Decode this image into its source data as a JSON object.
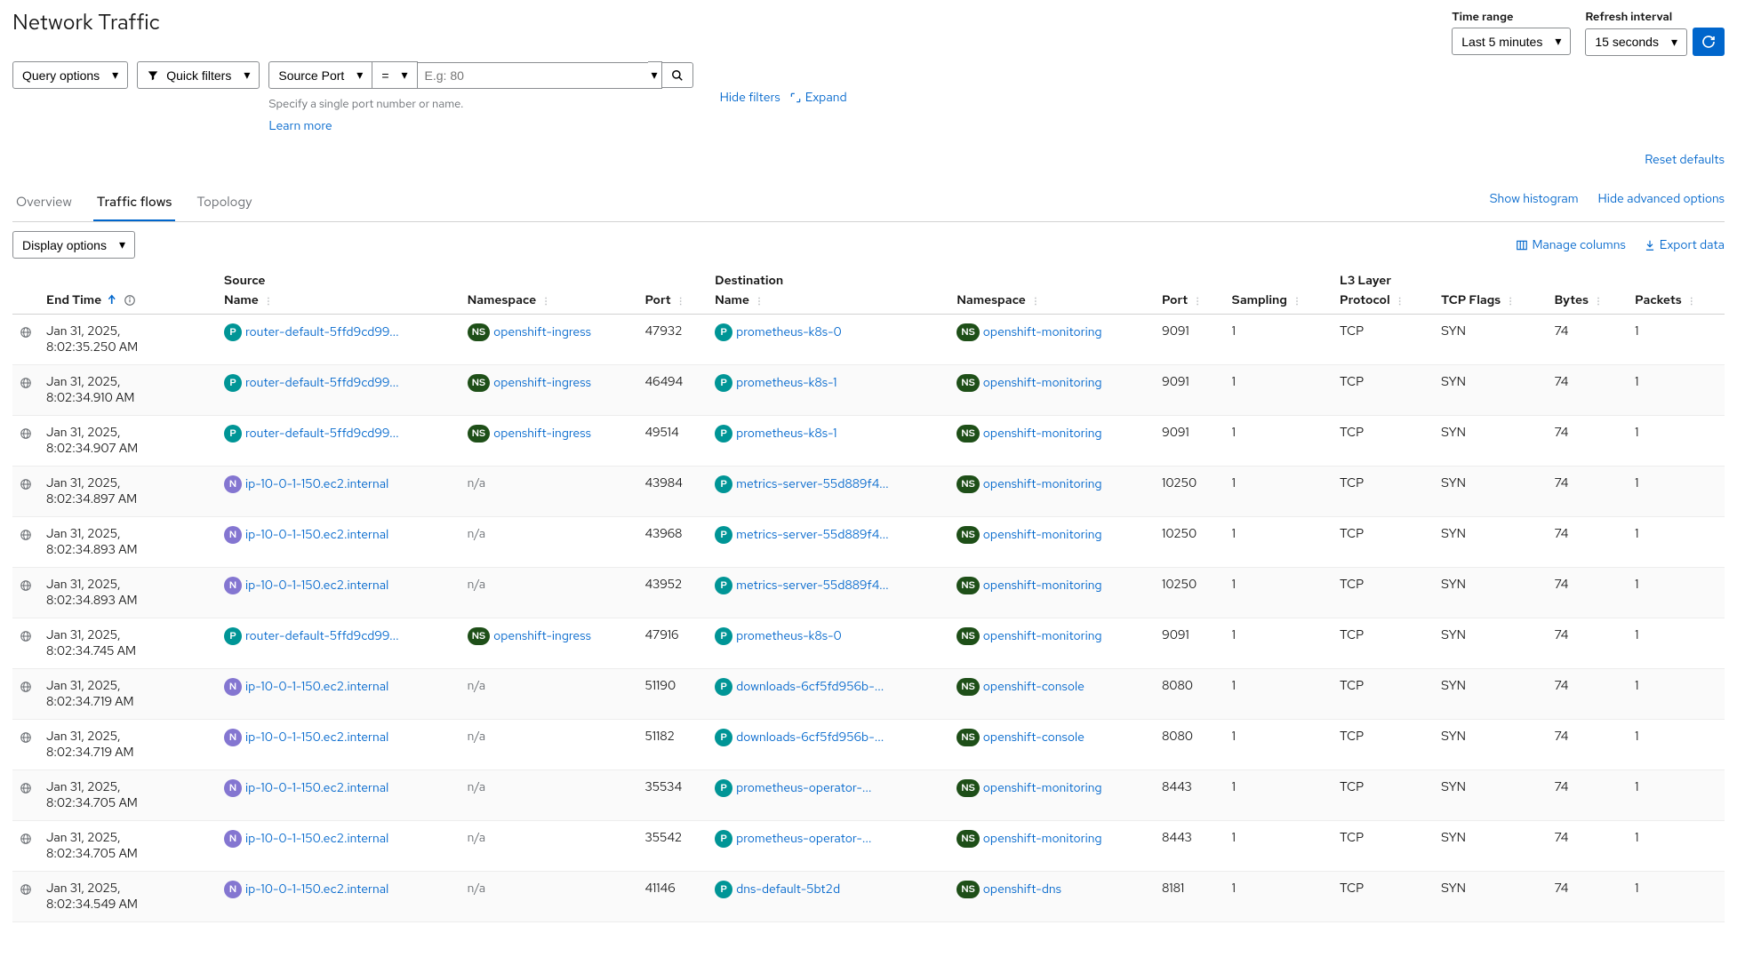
{
  "page_title": "Network Traffic",
  "time_range": {
    "label": "Time range",
    "value": "Last 5 minutes"
  },
  "refresh_interval": {
    "label": "Refresh interval",
    "value": "15 seconds"
  },
  "toolbar": {
    "query_options": "Query options",
    "quick_filters": "Quick filters",
    "filter_field": "Source Port",
    "filter_op": "=",
    "filter_placeholder": "E.g: 80",
    "helper": "Specify a single port number or name.",
    "learn_more": "Learn more",
    "hide_filters": "Hide filters",
    "expand": "Expand"
  },
  "reset_defaults": "Reset defaults",
  "tabs": {
    "overview": "Overview",
    "traffic_flows": "Traffic flows",
    "topology": "Topology"
  },
  "tab_links": {
    "show_histogram": "Show histogram",
    "hide_advanced": "Hide advanced options"
  },
  "display_options": "Display options",
  "manage_columns": "Manage columns",
  "export_data": "Export data",
  "columns": {
    "end_time": "End Time",
    "source": "Source",
    "destination": "Destination",
    "l3": "L3 Layer",
    "name": "Name",
    "namespace": "Namespace",
    "port": "Port",
    "sampling": "Sampling",
    "protocol": "Protocol",
    "tcp_flags": "TCP Flags",
    "bytes": "Bytes",
    "packets": "Packets"
  },
  "rows": [
    {
      "time_date": "Jan 31, 2025,",
      "time_ts": "8:02:35.250 AM",
      "src_badge": "P",
      "src_name": "router-default-5ffd9cd99...",
      "src_ns": "openshift-ingress",
      "src_port": "47932",
      "dst_badge": "P",
      "dst_name": "prometheus-k8s-0",
      "dst_ns": "openshift-monitoring",
      "dst_port": "9091",
      "sampling": "1",
      "proto": "TCP",
      "flags": "SYN",
      "bytes": "74",
      "packets": "1"
    },
    {
      "time_date": "Jan 31, 2025,",
      "time_ts": "8:02:34.910 AM",
      "src_badge": "P",
      "src_name": "router-default-5ffd9cd99...",
      "src_ns": "openshift-ingress",
      "src_port": "46494",
      "dst_badge": "P",
      "dst_name": "prometheus-k8s-1",
      "dst_ns": "openshift-monitoring",
      "dst_port": "9091",
      "sampling": "1",
      "proto": "TCP",
      "flags": "SYN",
      "bytes": "74",
      "packets": "1"
    },
    {
      "time_date": "Jan 31, 2025,",
      "time_ts": "8:02:34.907 AM",
      "src_badge": "P",
      "src_name": "router-default-5ffd9cd99...",
      "src_ns": "openshift-ingress",
      "src_port": "49514",
      "dst_badge": "P",
      "dst_name": "prometheus-k8s-1",
      "dst_ns": "openshift-monitoring",
      "dst_port": "9091",
      "sampling": "1",
      "proto": "TCP",
      "flags": "SYN",
      "bytes": "74",
      "packets": "1"
    },
    {
      "time_date": "Jan 31, 2025,",
      "time_ts": "8:02:34.897 AM",
      "src_badge": "N",
      "src_name": "ip-10-0-1-150.ec2.internal",
      "src_ns": "",
      "src_port": "43984",
      "dst_badge": "P",
      "dst_name": "metrics-server-55d889f4...",
      "dst_ns": "openshift-monitoring",
      "dst_port": "10250",
      "sampling": "1",
      "proto": "TCP",
      "flags": "SYN",
      "bytes": "74",
      "packets": "1"
    },
    {
      "time_date": "Jan 31, 2025,",
      "time_ts": "8:02:34.893 AM",
      "src_badge": "N",
      "src_name": "ip-10-0-1-150.ec2.internal",
      "src_ns": "",
      "src_port": "43968",
      "dst_badge": "P",
      "dst_name": "metrics-server-55d889f4...",
      "dst_ns": "openshift-monitoring",
      "dst_port": "10250",
      "sampling": "1",
      "proto": "TCP",
      "flags": "SYN",
      "bytes": "74",
      "packets": "1"
    },
    {
      "time_date": "Jan 31, 2025,",
      "time_ts": "8:02:34.893 AM",
      "src_badge": "N",
      "src_name": "ip-10-0-1-150.ec2.internal",
      "src_ns": "",
      "src_port": "43952",
      "dst_badge": "P",
      "dst_name": "metrics-server-55d889f4...",
      "dst_ns": "openshift-monitoring",
      "dst_port": "10250",
      "sampling": "1",
      "proto": "TCP",
      "flags": "SYN",
      "bytes": "74",
      "packets": "1"
    },
    {
      "time_date": "Jan 31, 2025,",
      "time_ts": "8:02:34.745 AM",
      "src_badge": "P",
      "src_name": "router-default-5ffd9cd99...",
      "src_ns": "openshift-ingress",
      "src_port": "47916",
      "dst_badge": "P",
      "dst_name": "prometheus-k8s-0",
      "dst_ns": "openshift-monitoring",
      "dst_port": "9091",
      "sampling": "1",
      "proto": "TCP",
      "flags": "SYN",
      "bytes": "74",
      "packets": "1"
    },
    {
      "time_date": "Jan 31, 2025,",
      "time_ts": "8:02:34.719 AM",
      "src_badge": "N",
      "src_name": "ip-10-0-1-150.ec2.internal",
      "src_ns": "",
      "src_port": "51190",
      "dst_badge": "P",
      "dst_name": "downloads-6cf5fd956b-...",
      "dst_ns": "openshift-console",
      "dst_port": "8080",
      "sampling": "1",
      "proto": "TCP",
      "flags": "SYN",
      "bytes": "74",
      "packets": "1"
    },
    {
      "time_date": "Jan 31, 2025,",
      "time_ts": "8:02:34.719 AM",
      "src_badge": "N",
      "src_name": "ip-10-0-1-150.ec2.internal",
      "src_ns": "",
      "src_port": "51182",
      "dst_badge": "P",
      "dst_name": "downloads-6cf5fd956b-...",
      "dst_ns": "openshift-console",
      "dst_port": "8080",
      "sampling": "1",
      "proto": "TCP",
      "flags": "SYN",
      "bytes": "74",
      "packets": "1"
    },
    {
      "time_date": "Jan 31, 2025,",
      "time_ts": "8:02:34.705 AM",
      "src_badge": "N",
      "src_name": "ip-10-0-1-150.ec2.internal",
      "src_ns": "",
      "src_port": "35534",
      "dst_badge": "P",
      "dst_name": "prometheus-operator-...",
      "dst_ns": "openshift-monitoring",
      "dst_port": "8443",
      "sampling": "1",
      "proto": "TCP",
      "flags": "SYN",
      "bytes": "74",
      "packets": "1"
    },
    {
      "time_date": "Jan 31, 2025,",
      "time_ts": "8:02:34.705 AM",
      "src_badge": "N",
      "src_name": "ip-10-0-1-150.ec2.internal",
      "src_ns": "",
      "src_port": "35542",
      "dst_badge": "P",
      "dst_name": "prometheus-operator-...",
      "dst_ns": "openshift-monitoring",
      "dst_port": "8443",
      "sampling": "1",
      "proto": "TCP",
      "flags": "SYN",
      "bytes": "74",
      "packets": "1"
    },
    {
      "time_date": "Jan 31, 2025,",
      "time_ts": "8:02:34.549 AM",
      "src_badge": "N",
      "src_name": "ip-10-0-1-150.ec2.internal",
      "src_ns": "",
      "src_port": "41146",
      "dst_badge": "P",
      "dst_name": "dns-default-5bt2d",
      "dst_ns": "openshift-dns",
      "dst_port": "8181",
      "sampling": "1",
      "proto": "TCP",
      "flags": "SYN",
      "bytes": "74",
      "packets": "1"
    }
  ],
  "na": "n/a"
}
